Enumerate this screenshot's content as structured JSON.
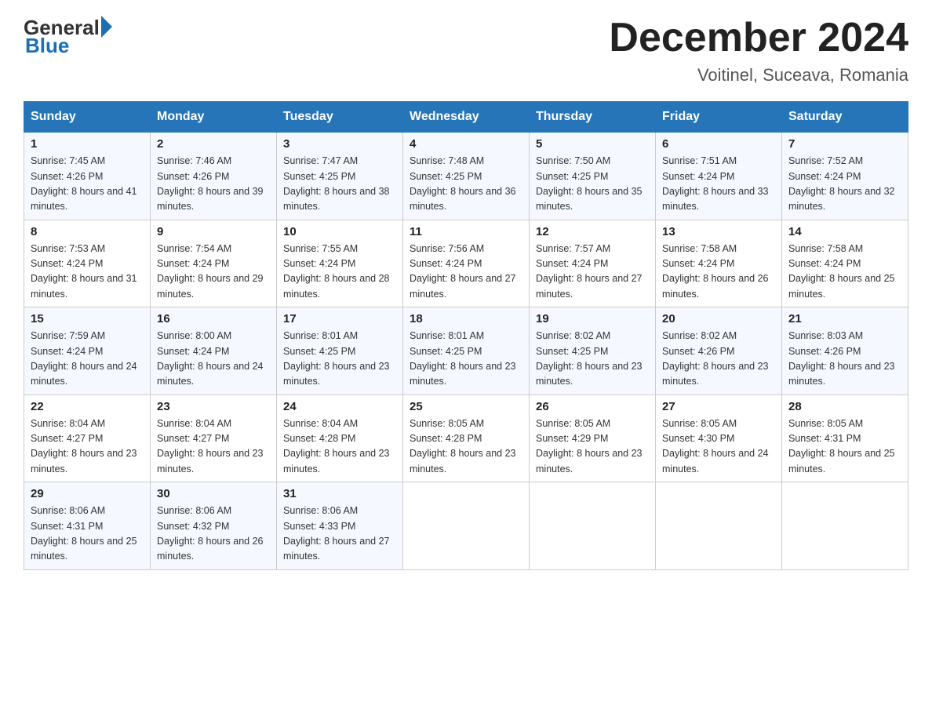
{
  "logo": {
    "general": "General",
    "arrow": "▶",
    "blue": "Blue"
  },
  "title": "December 2024",
  "location": "Voitinel, Suceava, Romania",
  "days_of_week": [
    "Sunday",
    "Monday",
    "Tuesday",
    "Wednesday",
    "Thursday",
    "Friday",
    "Saturday"
  ],
  "weeks": [
    [
      {
        "day": "1",
        "sunrise": "7:45 AM",
        "sunset": "4:26 PM",
        "daylight": "8 hours and 41 minutes."
      },
      {
        "day": "2",
        "sunrise": "7:46 AM",
        "sunset": "4:26 PM",
        "daylight": "8 hours and 39 minutes."
      },
      {
        "day": "3",
        "sunrise": "7:47 AM",
        "sunset": "4:25 PM",
        "daylight": "8 hours and 38 minutes."
      },
      {
        "day": "4",
        "sunrise": "7:48 AM",
        "sunset": "4:25 PM",
        "daylight": "8 hours and 36 minutes."
      },
      {
        "day": "5",
        "sunrise": "7:50 AM",
        "sunset": "4:25 PM",
        "daylight": "8 hours and 35 minutes."
      },
      {
        "day": "6",
        "sunrise": "7:51 AM",
        "sunset": "4:24 PM",
        "daylight": "8 hours and 33 minutes."
      },
      {
        "day": "7",
        "sunrise": "7:52 AM",
        "sunset": "4:24 PM",
        "daylight": "8 hours and 32 minutes."
      }
    ],
    [
      {
        "day": "8",
        "sunrise": "7:53 AM",
        "sunset": "4:24 PM",
        "daylight": "8 hours and 31 minutes."
      },
      {
        "day": "9",
        "sunrise": "7:54 AM",
        "sunset": "4:24 PM",
        "daylight": "8 hours and 29 minutes."
      },
      {
        "day": "10",
        "sunrise": "7:55 AM",
        "sunset": "4:24 PM",
        "daylight": "8 hours and 28 minutes."
      },
      {
        "day": "11",
        "sunrise": "7:56 AM",
        "sunset": "4:24 PM",
        "daylight": "8 hours and 27 minutes."
      },
      {
        "day": "12",
        "sunrise": "7:57 AM",
        "sunset": "4:24 PM",
        "daylight": "8 hours and 27 minutes."
      },
      {
        "day": "13",
        "sunrise": "7:58 AM",
        "sunset": "4:24 PM",
        "daylight": "8 hours and 26 minutes."
      },
      {
        "day": "14",
        "sunrise": "7:58 AM",
        "sunset": "4:24 PM",
        "daylight": "8 hours and 25 minutes."
      }
    ],
    [
      {
        "day": "15",
        "sunrise": "7:59 AM",
        "sunset": "4:24 PM",
        "daylight": "8 hours and 24 minutes."
      },
      {
        "day": "16",
        "sunrise": "8:00 AM",
        "sunset": "4:24 PM",
        "daylight": "8 hours and 24 minutes."
      },
      {
        "day": "17",
        "sunrise": "8:01 AM",
        "sunset": "4:25 PM",
        "daylight": "8 hours and 23 minutes."
      },
      {
        "day": "18",
        "sunrise": "8:01 AM",
        "sunset": "4:25 PM",
        "daylight": "8 hours and 23 minutes."
      },
      {
        "day": "19",
        "sunrise": "8:02 AM",
        "sunset": "4:25 PM",
        "daylight": "8 hours and 23 minutes."
      },
      {
        "day": "20",
        "sunrise": "8:02 AM",
        "sunset": "4:26 PM",
        "daylight": "8 hours and 23 minutes."
      },
      {
        "day": "21",
        "sunrise": "8:03 AM",
        "sunset": "4:26 PM",
        "daylight": "8 hours and 23 minutes."
      }
    ],
    [
      {
        "day": "22",
        "sunrise": "8:04 AM",
        "sunset": "4:27 PM",
        "daylight": "8 hours and 23 minutes."
      },
      {
        "day": "23",
        "sunrise": "8:04 AM",
        "sunset": "4:27 PM",
        "daylight": "8 hours and 23 minutes."
      },
      {
        "day": "24",
        "sunrise": "8:04 AM",
        "sunset": "4:28 PM",
        "daylight": "8 hours and 23 minutes."
      },
      {
        "day": "25",
        "sunrise": "8:05 AM",
        "sunset": "4:28 PM",
        "daylight": "8 hours and 23 minutes."
      },
      {
        "day": "26",
        "sunrise": "8:05 AM",
        "sunset": "4:29 PM",
        "daylight": "8 hours and 23 minutes."
      },
      {
        "day": "27",
        "sunrise": "8:05 AM",
        "sunset": "4:30 PM",
        "daylight": "8 hours and 24 minutes."
      },
      {
        "day": "28",
        "sunrise": "8:05 AM",
        "sunset": "4:31 PM",
        "daylight": "8 hours and 25 minutes."
      }
    ],
    [
      {
        "day": "29",
        "sunrise": "8:06 AM",
        "sunset": "4:31 PM",
        "daylight": "8 hours and 25 minutes."
      },
      {
        "day": "30",
        "sunrise": "8:06 AM",
        "sunset": "4:32 PM",
        "daylight": "8 hours and 26 minutes."
      },
      {
        "day": "31",
        "sunrise": "8:06 AM",
        "sunset": "4:33 PM",
        "daylight": "8 hours and 27 minutes."
      },
      null,
      null,
      null,
      null
    ]
  ]
}
